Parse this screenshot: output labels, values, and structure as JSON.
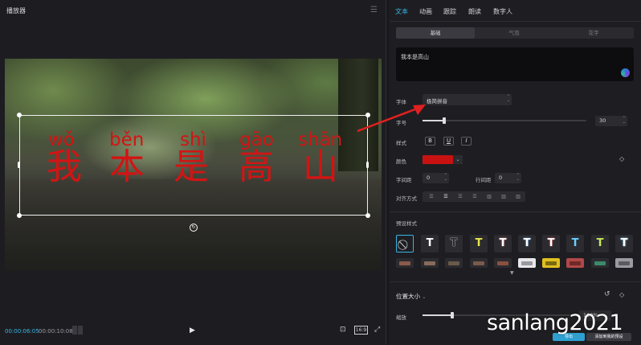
{
  "player": {
    "title": "播放器",
    "time_current": "00:00:06:05",
    "time_total": "00:00:10:08",
    "ratio_label": "16:9",
    "overlay_pinyin": [
      "wǒ",
      "běn",
      "shì",
      "gāo",
      "shān"
    ],
    "overlay_hanzi": [
      "我",
      "本",
      "是",
      "高",
      "山"
    ],
    "overlay_color": "#d21414"
  },
  "tabs": [
    "文本",
    "动画",
    "跟踪",
    "朗读",
    "数字人"
  ],
  "subtabs": [
    "基础",
    "气泡",
    "花字"
  ],
  "text_content": "我本是高山",
  "font": {
    "label": "字体",
    "value": "极简拼音"
  },
  "size": {
    "label": "字号",
    "value": "30",
    "fraction": 0.13
  },
  "style": {
    "label": "样式",
    "buttons": [
      "B",
      "U",
      "I"
    ]
  },
  "color": {
    "label": "颜色",
    "value": "#c81212"
  },
  "spacing": {
    "char_label": "字间距",
    "char_value": "0",
    "line_label": "行间距",
    "line_value": "0"
  },
  "align": {
    "label": "对齐方式"
  },
  "presets": {
    "label": "预设样式",
    "colors": [
      "#ffffff",
      "#ffffff",
      "#e8e84a",
      "#f0a0a0",
      "#9ad0ff",
      "#ff6a6a",
      "#6ad0ff",
      "#c8e85a",
      "#8ae0ff"
    ],
    "row2": [
      "#8a5a4a",
      "#8a6a5a",
      "#6a5a4a",
      "#7a5a4a",
      "#f0f0f0",
      "#f0d020",
      "#d05050",
      "#3a8a6a",
      "#b0b0b0"
    ]
  },
  "position": {
    "label": "位置大小",
    "scale_label": "缩放",
    "scale_value": "100%",
    "scale_fraction": 0.2
  },
  "buttons": {
    "primary": "导出",
    "secondary": "添加到我的预设"
  },
  "watermark": "sanlang2021",
  "accent": "#37b6e6"
}
